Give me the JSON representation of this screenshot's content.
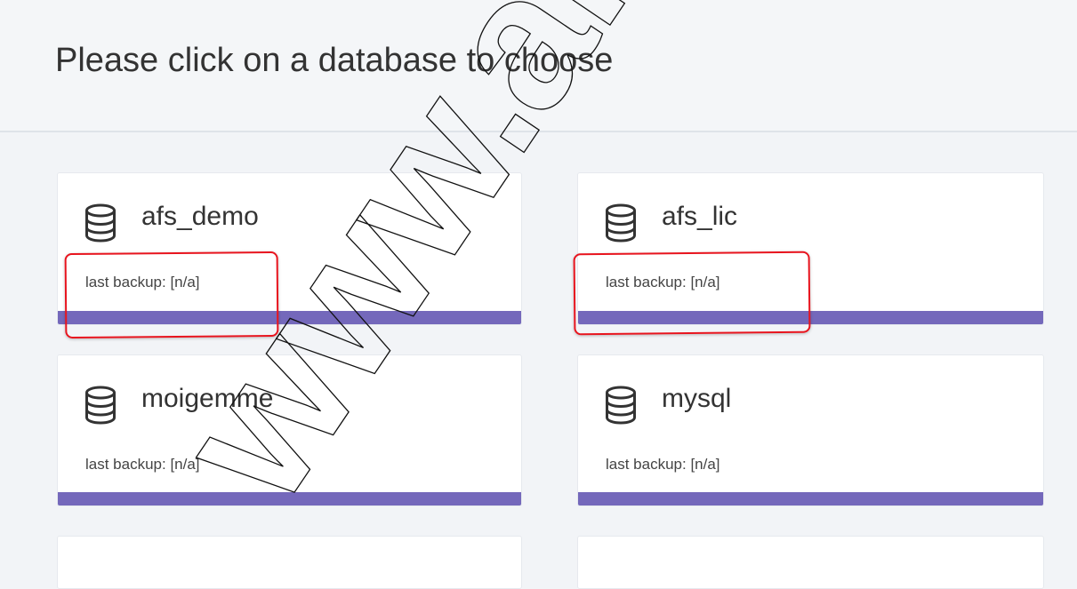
{
  "header": {
    "title": "Please click on a database to choose"
  },
  "databases": [
    {
      "name": "afs_demo",
      "backup_text": "last backup: [n/a]"
    },
    {
      "name": "afs_lic",
      "backup_text": "last backup: [n/a]"
    },
    {
      "name": "moigemme",
      "backup_text": "last backup: [n/a]"
    },
    {
      "name": "mysql",
      "backup_text": "last backup: [n/a]"
    },
    {
      "name": "",
      "backup_text": ""
    },
    {
      "name": "",
      "backup_text": ""
    }
  ],
  "watermark": {
    "text": "www.afs"
  },
  "colors": {
    "accent_bar": "#7468bb",
    "highlight": "#e8141e",
    "background": "#f2f4f7",
    "card": "#ffffff"
  },
  "icons": {
    "database": "database-icon"
  }
}
